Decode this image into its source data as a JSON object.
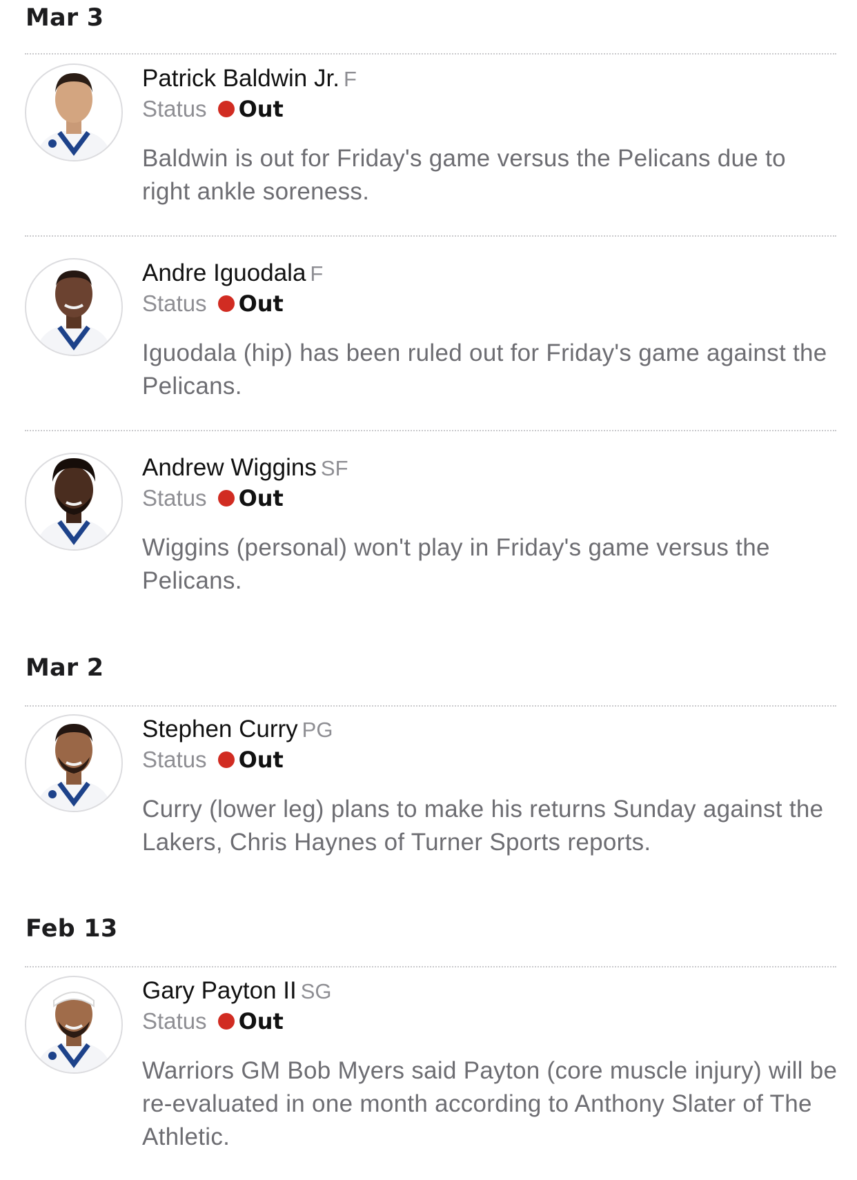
{
  "sections": [
    {
      "date": "Mar 3"
    },
    {
      "date": "Mar 2"
    },
    {
      "date": "Feb 13"
    }
  ],
  "players": [
    {
      "name": "Patrick Baldwin Jr.",
      "position": "F",
      "status_label": "Status",
      "status": "Out",
      "blurb": "Baldwin is out for Friday's game versus the Pelicans due to right ankle soreness."
    },
    {
      "name": "Andre Iguodala",
      "position": "F",
      "status_label": "Status",
      "status": "Out",
      "blurb": "Iguodala (hip) has been ruled out for Friday's game against the Pelicans."
    },
    {
      "name": "Andrew Wiggins",
      "position": "SF",
      "status_label": "Status",
      "status": "Out",
      "blurb": "Wiggins (personal) won't play in Friday's game versus the Pelicans."
    },
    {
      "name": "Stephen Curry",
      "position": "PG",
      "status_label": "Status",
      "status": "Out",
      "blurb": "Curry (lower leg) plans to make his returns Sunday against the Lakers, Chris Haynes of Turner Sports reports."
    },
    {
      "name": "Gary Payton II",
      "position": "SG",
      "status_label": "Status",
      "status": "Out",
      "blurb": "Warriors GM Bob Myers said Payton (core muscle injury) will be re-evaluated in one month according to Anthony Slater of The Athletic."
    }
  ],
  "colors": {
    "status_out": "#d12c22",
    "jersey": "#1d428a"
  }
}
